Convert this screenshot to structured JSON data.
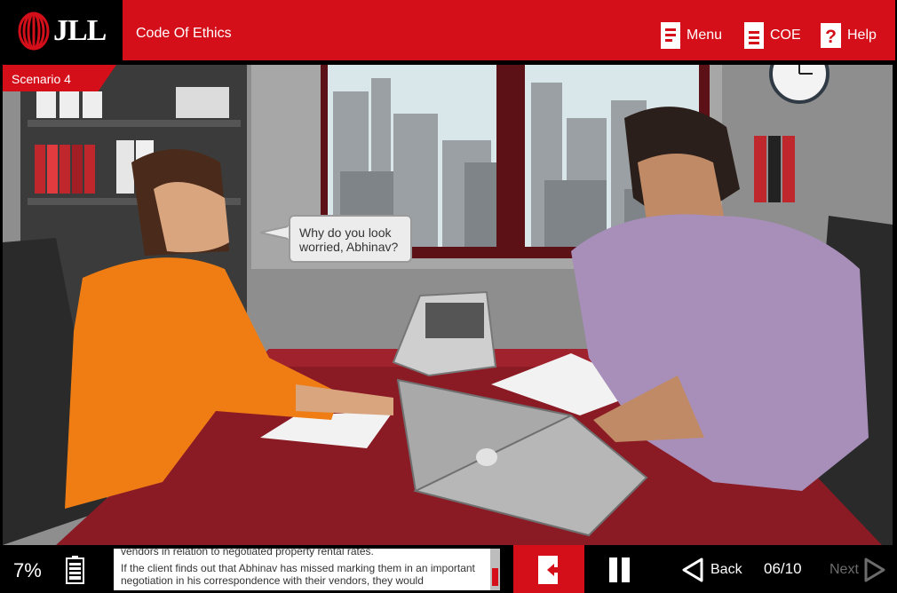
{
  "header": {
    "logo_text": "JLL",
    "course_title": "Code Of Ethics",
    "menu_label": "Menu",
    "coe_label": "COE",
    "help_label": "Help"
  },
  "scene": {
    "scenario_label": "Scenario 4",
    "speech_bubble_line1": "Why do you look",
    "speech_bubble_line2": "worried, Abhinav?"
  },
  "footer": {
    "progress_percent": "7%",
    "transcript_line1": "vendors in relation to negotiated property rental rates.",
    "transcript_line2": "If the client finds out that Abhinav has missed marking them in an important negotiation in his correspondence with their vendors, they would",
    "back_label": "Back",
    "slide_counter": "06/10",
    "next_label": "Next"
  },
  "colors": {
    "brand_red": "#d50f1a",
    "header_black": "#000000",
    "disabled_gray": "#6c6c6c"
  },
  "icons": {
    "menu": "menu-icon",
    "coe": "document-icon",
    "help": "question-icon",
    "battery": "battery-icon",
    "exit": "exit-icon",
    "pause": "pause-icon",
    "back": "arrow-left-icon",
    "next": "arrow-right-icon"
  }
}
